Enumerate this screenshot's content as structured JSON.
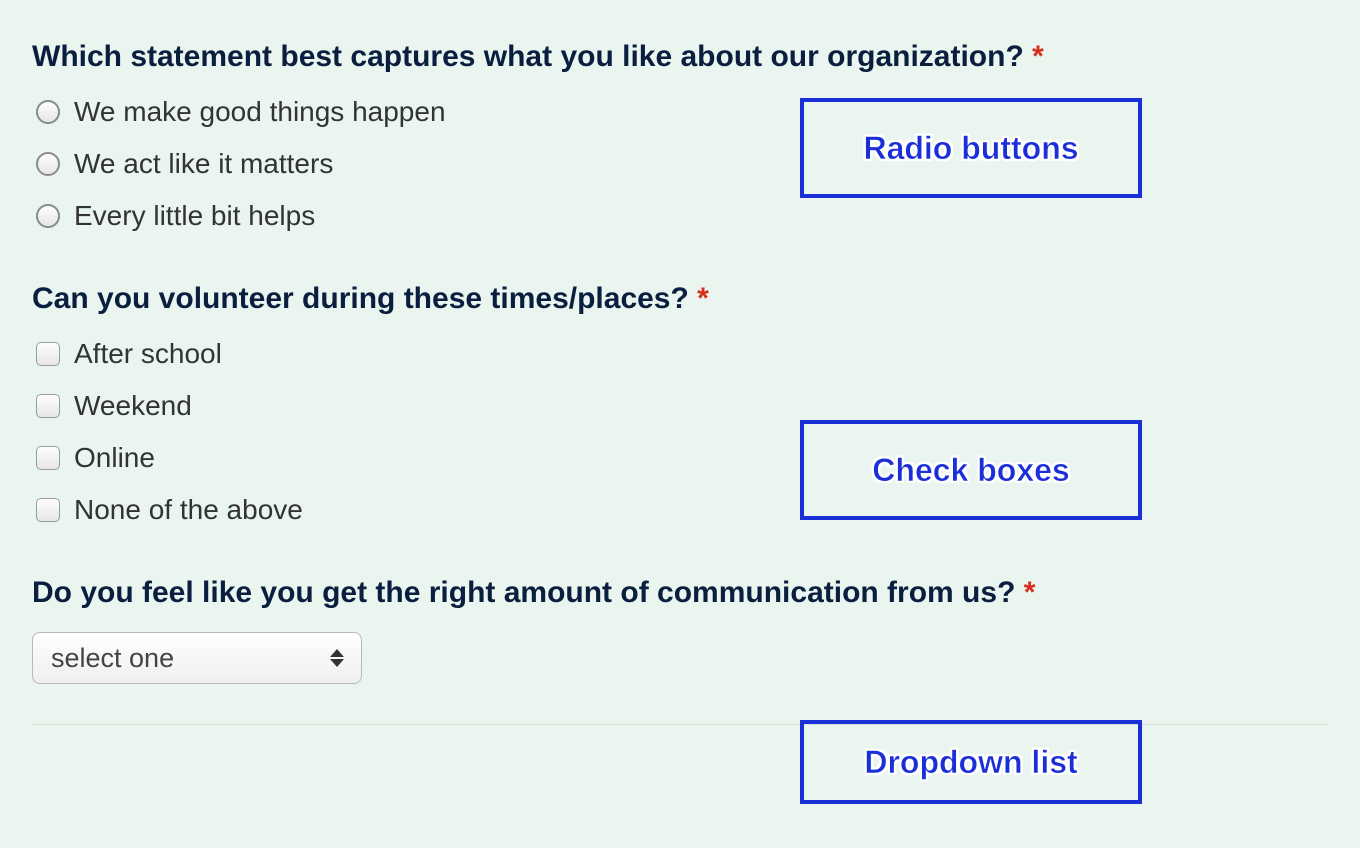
{
  "q1": {
    "title": "Which statement best captures what you like about our organization?",
    "required_mark": "*",
    "options": [
      "We make good things happen",
      "We act like it matters",
      "Every little bit helps"
    ]
  },
  "q2": {
    "title": "Can you volunteer during these times/places?",
    "required_mark": "*",
    "options": [
      "After school",
      "Weekend",
      "Online",
      "None of the above"
    ]
  },
  "q3": {
    "title": "Do you feel like you get the right amount of communication from us?",
    "required_mark": "*",
    "select_placeholder": "select one"
  },
  "callouts": {
    "radio": "Radio buttons",
    "checkbox": "Check boxes",
    "dropdown": "Dropdown list"
  }
}
